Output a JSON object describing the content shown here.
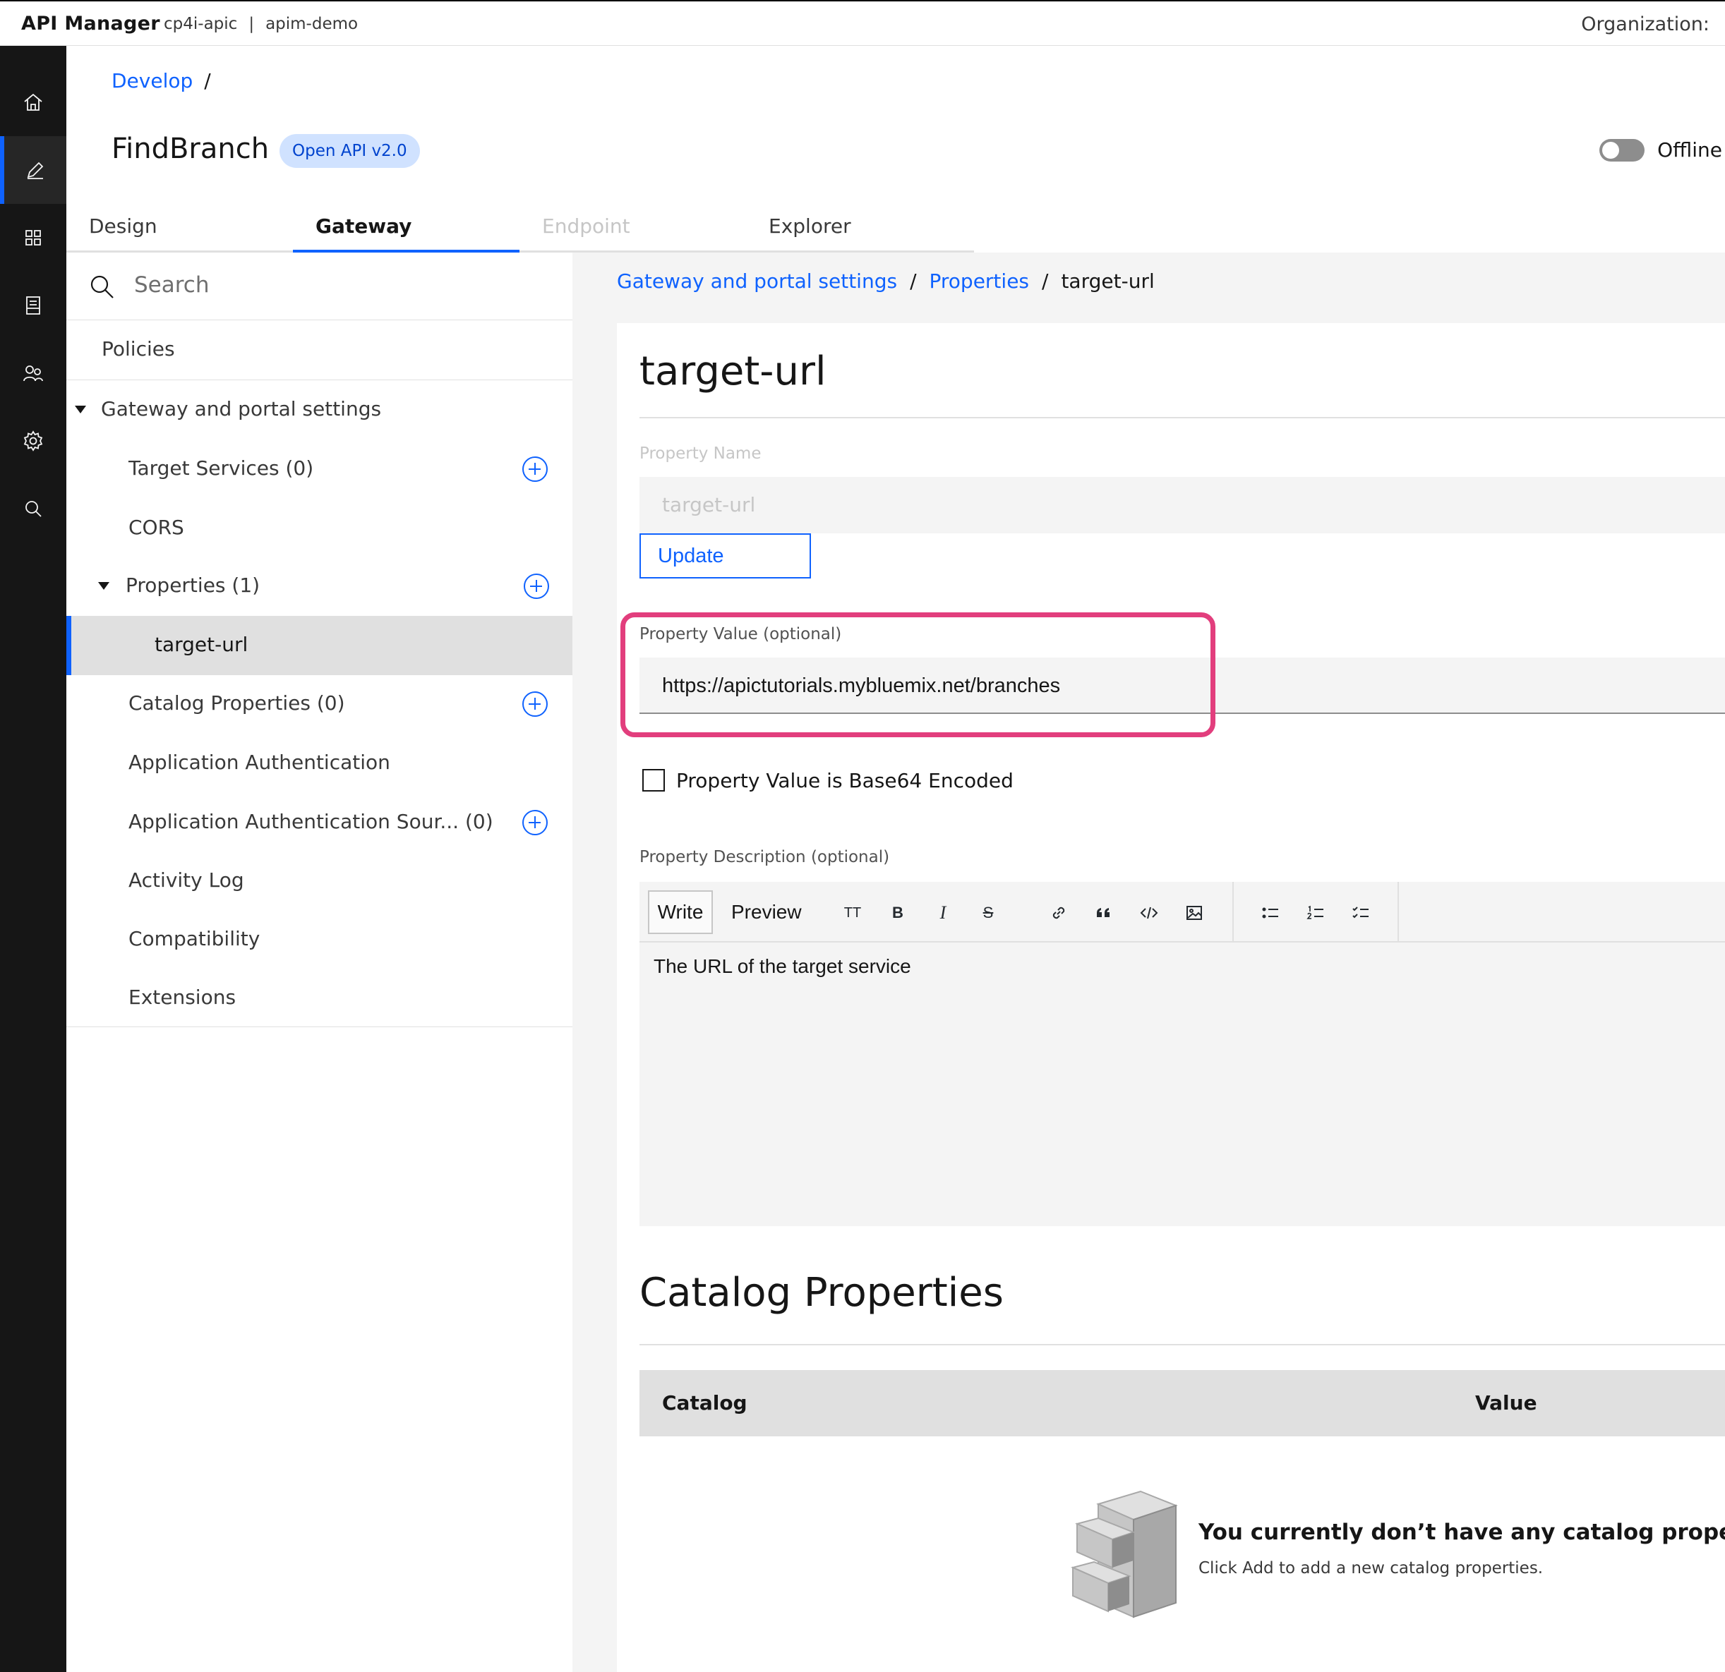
{
  "header": {
    "brand": "API Manager",
    "context_cluster": "cp4i-apic",
    "context_separator": "|",
    "context_instance": "apim-demo",
    "organization_label": "Organization:"
  },
  "rail": {
    "icons": [
      "home-icon",
      "edit-icon",
      "apps-icon",
      "catalog-icon",
      "members-icon",
      "settings-icon",
      "search-icon"
    ],
    "active": "edit-icon"
  },
  "page": {
    "breadcrumb_link": "Develop",
    "breadcrumb_sep": "/",
    "api_name": "FindBranch",
    "api_tag": "Open API v2.0",
    "offline_label": "Offline",
    "offline_on": false
  },
  "tabs": [
    {
      "label": "Design",
      "state": "normal"
    },
    {
      "label": "Gateway",
      "state": "active"
    },
    {
      "label": "Endpoint",
      "state": "disabled"
    },
    {
      "label": "Explorer",
      "state": "normal"
    }
  ],
  "tree": {
    "search_placeholder": "Search",
    "items": [
      {
        "label": "Policies"
      },
      {
        "label": "Gateway and portal settings"
      },
      {
        "label": "Target Services (0)"
      },
      {
        "label": "CORS"
      },
      {
        "label": "Properties (1)"
      },
      {
        "label": "target-url"
      },
      {
        "label": "Catalog Properties (0)"
      },
      {
        "label": "Application Authentication"
      },
      {
        "label": "Application Authentication Sour... (0)"
      },
      {
        "label": "Activity Log"
      },
      {
        "label": "Compatibility"
      },
      {
        "label": "Extensions"
      }
    ]
  },
  "detail": {
    "breadcrumb": [
      "Gateway and portal settings",
      "Properties",
      "target-url"
    ],
    "breadcrumb_sep": "/",
    "title": "target-url",
    "property_name_label": "Property Name",
    "property_name_value": "target-url",
    "update_button": "Update",
    "property_value_label": "Property Value (optional)",
    "property_value": "https://apictutorials.mybluemix.net/branches",
    "base64_label": "Property Value is Base64 Encoded",
    "base64_checked": false,
    "description_label": "Property Description (optional)",
    "editor": {
      "write_tab": "Write",
      "preview_tab": "Preview",
      "tools": [
        "TT",
        "B",
        "I",
        "S",
        "link-icon",
        "quote-icon",
        "code-icon",
        "image-icon",
        "bullet-list-icon",
        "numbered-list-icon",
        "task-list-icon"
      ],
      "content": "The URL of the target service"
    },
    "catalog_heading": "Catalog Properties",
    "catalog_columns": [
      "Catalog",
      "Value"
    ],
    "empty_title": "You currently don’t have any catalog properties.",
    "empty_subtitle": "Click Add to add a new catalog properties."
  },
  "colors": {
    "accent": "#0f62fe",
    "highlight": "#e23e7d",
    "rail_bg": "#161616",
    "tag_bg": "#d0e2ff"
  }
}
